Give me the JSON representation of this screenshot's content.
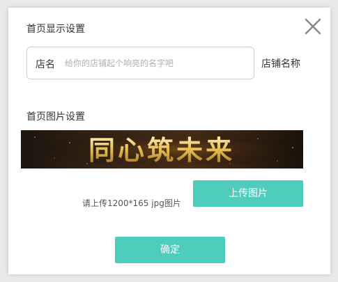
{
  "dialog": {
    "homepage_display_title": "首页显示设置",
    "shop_name_label": "店名",
    "shop_name_placeholder": "给你的店铺起个响亮的名字吧",
    "shop_name_value": "",
    "shop_name_side_label": "店铺名称",
    "homepage_image_title": "首页图片设置",
    "banner_text": "同心筑未来",
    "upload_hint": "请上传1200*165 jpg图片",
    "upload_button_label": "上传图片",
    "confirm_button_label": "确定",
    "close_icon": "close-x-icon"
  },
  "colors": {
    "accent": "#4ecdbd",
    "banner_text": "#e8c15a",
    "banner_bg": "#2a1e12"
  }
}
